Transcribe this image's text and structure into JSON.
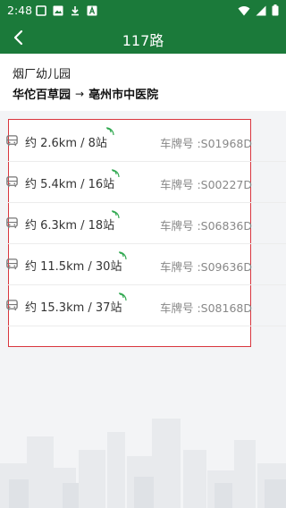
{
  "status_bar": {
    "time": "2:48",
    "icons_left": [
      "notification-box-icon",
      "image-icon",
      "download-icon",
      "text-a-icon"
    ],
    "icons_right": [
      "wifi-icon",
      "signal-icon",
      "battery-icon"
    ]
  },
  "app_bar": {
    "back_icon": "chevron-left-icon",
    "title": "117路"
  },
  "route_header": {
    "stop_name": "烟厂幼儿园",
    "from": "华佗百草园",
    "arrow": "→",
    "to": "亳州市中医院"
  },
  "buses": [
    {
      "distance": "约 2.6km / 8站",
      "plate": "车牌号 :S01968D"
    },
    {
      "distance": "约 5.4km / 16站",
      "plate": "车牌号 :S00227D"
    },
    {
      "distance": "约 6.3km / 18站",
      "plate": "车牌号 :S06836D"
    },
    {
      "distance": "约 11.5km / 30站",
      "plate": "车牌号 :S09636D"
    },
    {
      "distance": "约 15.3km / 37站",
      "plate": "车牌号 :S08168D"
    }
  ],
  "colors": {
    "primary": "#1b7a3a",
    "highlight_border": "#d9363e",
    "signal": "#2fa84f"
  }
}
